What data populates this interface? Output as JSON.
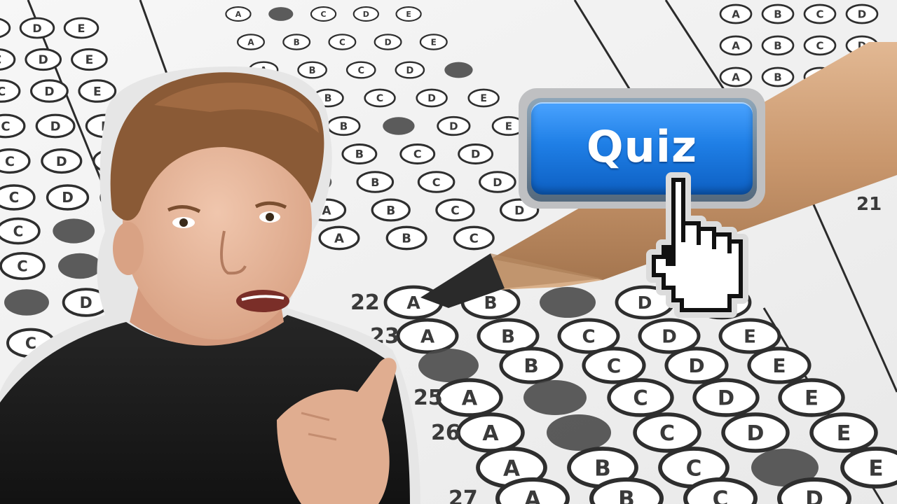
{
  "quiz_button": {
    "label": "Quiz"
  },
  "answer_sheet": {
    "row_numbers": [
      "21",
      "22",
      "23",
      "25",
      "26",
      "27"
    ],
    "choice_letters": [
      "A",
      "B",
      "C",
      "D",
      "E"
    ]
  },
  "icons": {
    "cursor": "hand-pointer-icon",
    "pencil": "pencil-icon"
  },
  "colors": {
    "button_blue": "#1f7fe6",
    "paper": "#f4f4f4",
    "filled_bubble": "#4a4a4a",
    "shirt": "#1c1c1c"
  }
}
